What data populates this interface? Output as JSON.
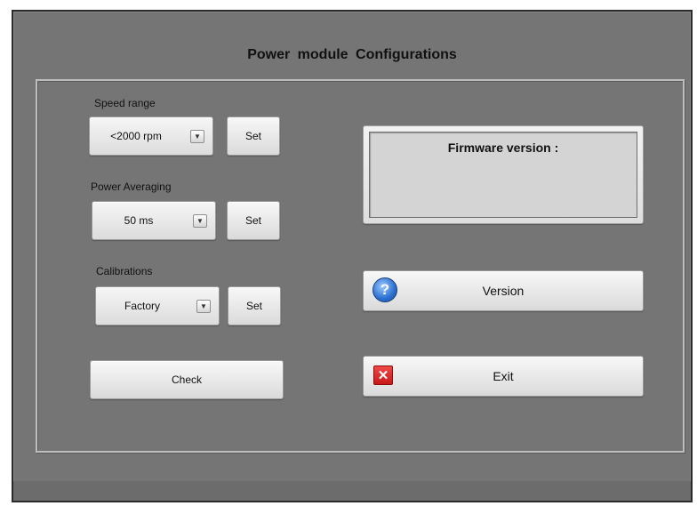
{
  "window": {
    "title": "Power module Configurations"
  },
  "speed_range": {
    "label": "Speed range",
    "selected": "<2000 rpm",
    "set_label": "Set"
  },
  "power_averaging": {
    "label": "Power Averaging",
    "selected": "50 ms",
    "set_label": "Set"
  },
  "calibrations": {
    "label": "Calibrations",
    "selected": "Factory",
    "set_label": "Set"
  },
  "check_label": "Check",
  "firmware": {
    "label": "Firmware version :",
    "value": ""
  },
  "version_button": {
    "label": "Version",
    "icon": "question-icon",
    "icon_glyph": "?",
    "icon_color": "#2a6fd0"
  },
  "exit_button": {
    "label": "Exit",
    "icon": "close-icon",
    "icon_glyph": "✕",
    "icon_color": "#d92626"
  },
  "dropdown_arrow_glyph": "▼"
}
